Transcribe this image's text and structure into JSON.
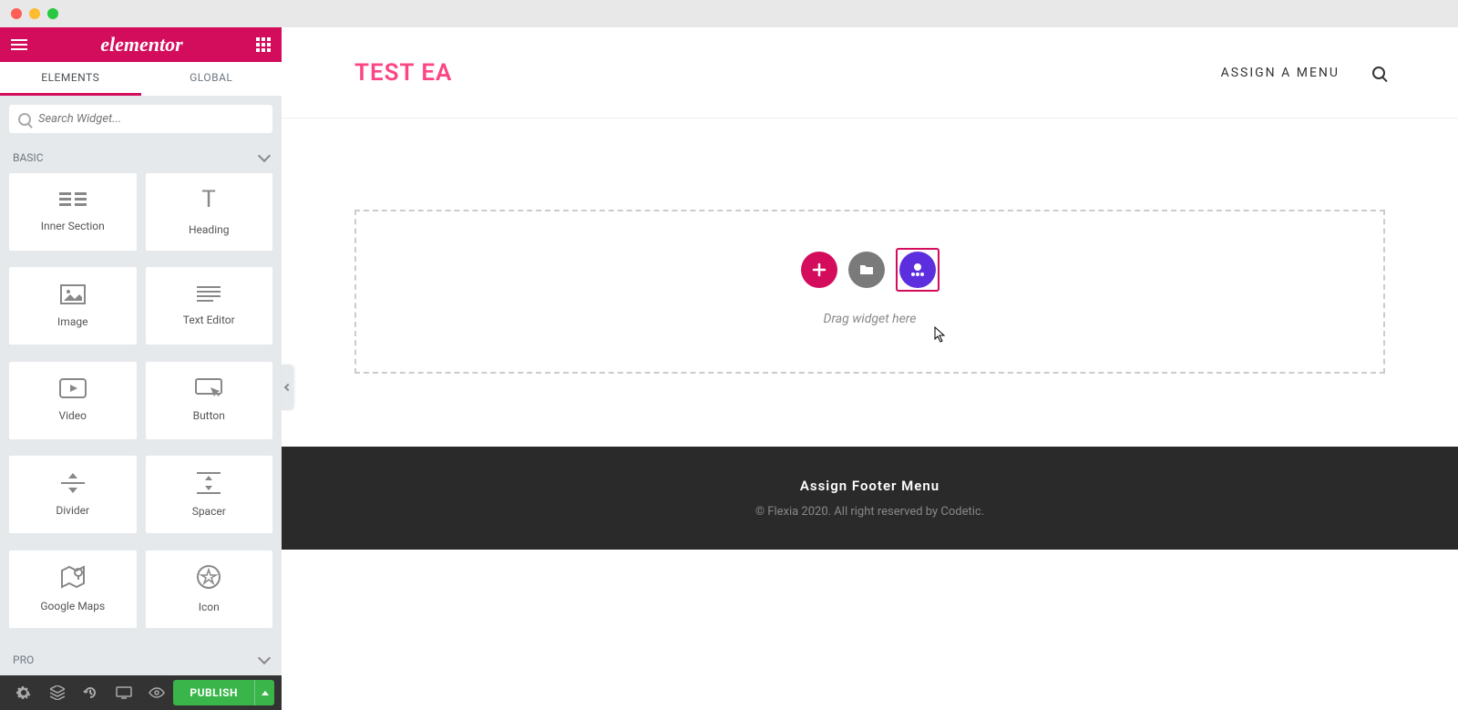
{
  "window": {
    "logo": "elementor"
  },
  "sidebar": {
    "tabs": {
      "elements": "ELEMENTS",
      "global": "GLOBAL"
    },
    "search_placeholder": "Search Widget...",
    "sections": {
      "basic": "BASIC",
      "pro": "PRO"
    },
    "widgets": [
      {
        "id": "inner-section",
        "label": "Inner Section"
      },
      {
        "id": "heading",
        "label": "Heading"
      },
      {
        "id": "image",
        "label": "Image"
      },
      {
        "id": "text-editor",
        "label": "Text Editor"
      },
      {
        "id": "video",
        "label": "Video"
      },
      {
        "id": "button",
        "label": "Button"
      },
      {
        "id": "divider",
        "label": "Divider"
      },
      {
        "id": "spacer",
        "label": "Spacer"
      },
      {
        "id": "google-maps",
        "label": "Google Maps"
      },
      {
        "id": "icon",
        "label": "Icon"
      }
    ],
    "publish": "PUBLISH"
  },
  "preview": {
    "site_title": "TEST EA",
    "menu_link": "ASSIGN A MENU",
    "drop_hint": "Drag widget here",
    "footer_title": "Assign Footer Menu",
    "footer_copy": "© Flexia 2020. All right reserved by Codetic."
  }
}
